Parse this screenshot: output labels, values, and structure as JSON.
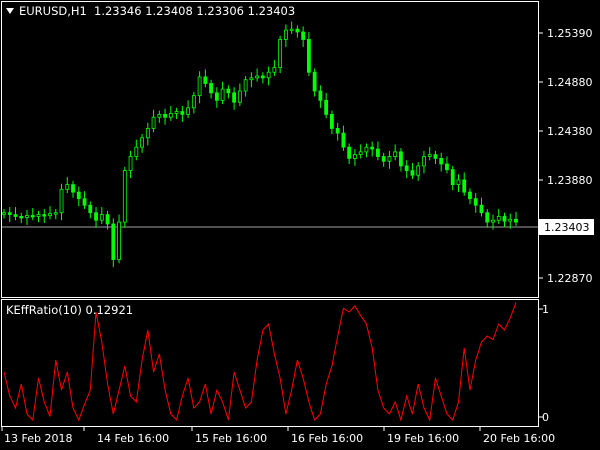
{
  "window": {
    "symbol_timeframe": "EURUSD,H1",
    "ohlc": "1.23346 1.23408 1.23306 1.23403",
    "menu_icon": "triangle-down-icon"
  },
  "indicator": {
    "label": "KEffRatio(10) 0.12921",
    "scale_top": "1",
    "scale_bottom": "0"
  },
  "colors": {
    "background": "#000000",
    "candles": "#00ff00",
    "indicator_line": "#ff0000",
    "current_price_line": "#a0a0a0"
  },
  "chart_data": [
    {
      "type": "line",
      "title": "EURUSD,H1",
      "series": [
        {
          "name": "EURUSD,H1",
          "values": [
            1.235,
            1.2348,
            1.2346,
            1.2345,
            1.2347,
            1.2346,
            1.2348,
            1.2347,
            1.2349,
            1.235,
            1.2375,
            1.238,
            1.2372,
            1.2365,
            1.2358,
            1.235,
            1.2342,
            1.2348,
            1.2338,
            1.23,
            1.234,
            1.2395,
            1.241,
            1.242,
            1.243,
            1.244,
            1.2452,
            1.2455,
            1.2452,
            1.2456,
            1.2458,
            1.2455,
            1.2462,
            1.2475,
            1.2495,
            1.2488,
            1.2478,
            1.247,
            1.2482,
            1.2478,
            1.2468,
            1.248,
            1.2492,
            1.2494,
            1.2496,
            1.2494,
            1.25,
            1.2505,
            1.2535,
            1.2545,
            1.2546,
            1.2543,
            1.2535,
            1.25,
            1.248,
            1.247,
            1.2455,
            1.244,
            1.2435,
            1.242,
            1.2408,
            1.2412,
            1.2415,
            1.242,
            1.2418,
            1.241,
            1.2405,
            1.241,
            1.2415,
            1.24,
            1.2395,
            1.239,
            1.24,
            1.241,
            1.2412,
            1.2408,
            1.2402,
            1.2396,
            1.238,
            1.2385,
            1.2372,
            1.2365,
            1.2358,
            1.235,
            1.234,
            1.2342,
            1.2346,
            1.2341,
            1.2343,
            1.234
          ]
        }
      ],
      "ylim": [
        1.226,
        1.2575
      ],
      "y_ticks": [
        "1.25390",
        "1.24880",
        "1.24380",
        "1.23880",
        "1.22870"
      ],
      "current_price": "1.23403",
      "x_ticks": [
        "13 Feb 2018",
        "14 Feb 16:00",
        "15 Feb 16:00",
        "16 Feb 16:00",
        "19 Feb 16:00",
        "20 Feb 16:00"
      ],
      "grid": false
    },
    {
      "type": "line",
      "title": "KEffRatio(10)",
      "series": [
        {
          "name": "KEffRatio(10)",
          "values": [
            0.45,
            0.25,
            0.15,
            0.35,
            0.1,
            0.05,
            0.4,
            0.2,
            0.08,
            0.55,
            0.3,
            0.45,
            0.15,
            0.05,
            0.18,
            0.3,
            0.95,
            0.7,
            0.35,
            0.1,
            0.3,
            0.5,
            0.25,
            0.2,
            0.55,
            0.8,
            0.45,
            0.6,
            0.3,
            0.1,
            0.05,
            0.25,
            0.4,
            0.15,
            0.2,
            0.35,
            0.1,
            0.3,
            0.2,
            0.05,
            0.45,
            0.3,
            0.15,
            0.2,
            0.55,
            0.8,
            0.85,
            0.6,
            0.4,
            0.1,
            0.3,
            0.55,
            0.4,
            0.2,
            0.05,
            0.1,
            0.35,
            0.5,
            0.75,
            0.98,
            0.95,
            1.0,
            0.92,
            0.85,
            0.65,
            0.3,
            0.15,
            0.1,
            0.2,
            0.05,
            0.25,
            0.1,
            0.35,
            0.15,
            0.05,
            0.4,
            0.25,
            0.1,
            0.05,
            0.2,
            0.65,
            0.3,
            0.55,
            0.7,
            0.75,
            0.72,
            0.85,
            0.8,
            0.9,
            1.03
          ]
        }
      ],
      "ylim": [
        0,
        1.05
      ],
      "y_ticks": [
        "1",
        "0"
      ]
    }
  ]
}
